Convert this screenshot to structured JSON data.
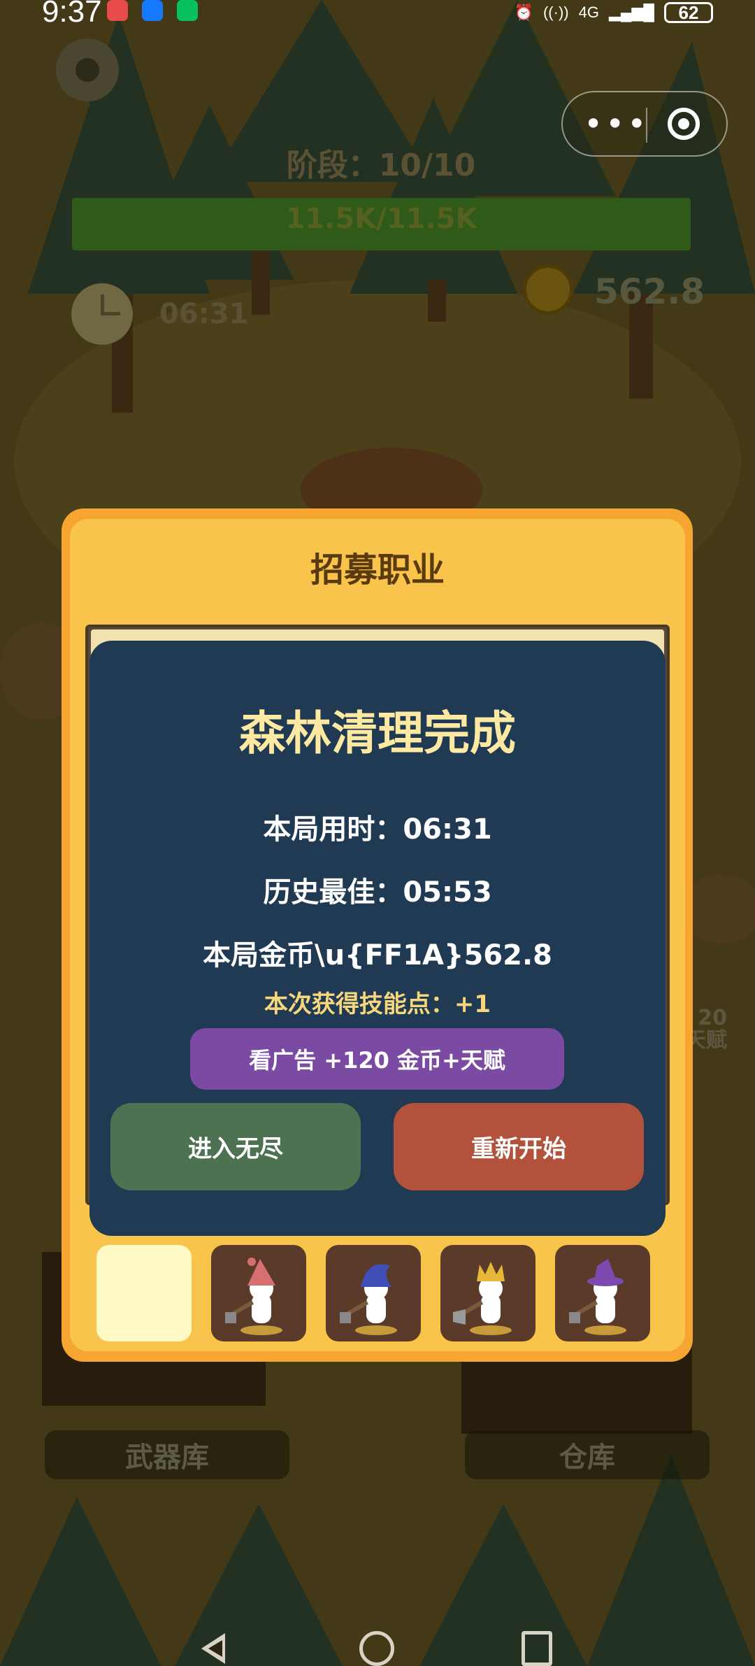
{
  "status_bar": {
    "time": "9:37",
    "battery": "62",
    "network": "4G"
  },
  "hud": {
    "stage": "阶段：10/10",
    "hp": "11.5K/11.5K",
    "timer": "06:31",
    "coins": "562.8",
    "side_reward_top": "20",
    "side_reward_bottom": "天赋"
  },
  "recruit_panel": {
    "title": "招募职业"
  },
  "result_dialog": {
    "title": "森林清理完成",
    "time_used": "本局用时：06:31",
    "best_time": "历史最佳：05:53",
    "coins_earned": "本局金币\\u{FF1A}562.8",
    "skill_points": "本次获得技能点：+1",
    "ad_button": "看广告 +120 金币+天赋",
    "endless_button": "进入无尽",
    "restart_button": "重新开始"
  },
  "bottom_buttons": {
    "armory": "武器库",
    "warehouse": "仓库"
  },
  "recruit_slots": [
    {
      "hat": "empty",
      "color": "#fff9c6"
    },
    {
      "hat": "red-hat",
      "color": "#c9686b"
    },
    {
      "hat": "blue-hat",
      "color": "#3f4fb6"
    },
    {
      "hat": "gold-crown",
      "color": "#e7b73a"
    },
    {
      "hat": "purple-wizard-hat",
      "color": "#7d4bb0"
    }
  ],
  "colors": {
    "dialog_bg": "#1f3a52",
    "panel_orange": "#f7a531",
    "endless_green": "#4c7252",
    "restart_red": "#b3523c",
    "ad_purple": "#7b4ba4",
    "title_yellow": "#fde9a1"
  }
}
